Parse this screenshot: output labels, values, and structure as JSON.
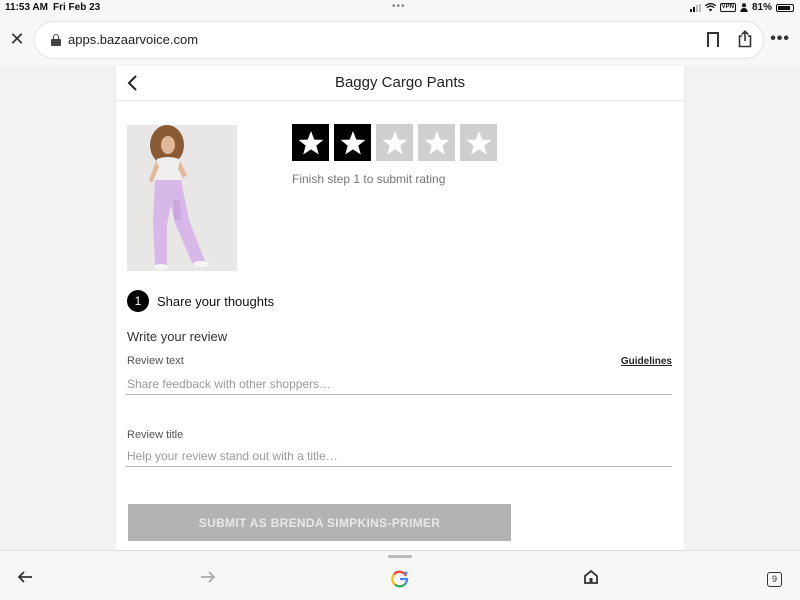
{
  "status_bar": {
    "time": "11:53 AM",
    "date": "Fri Feb 23",
    "battery": "81%",
    "vpn": "VPN",
    "icons": [
      "signal-icon",
      "wifi-icon",
      "vpn-icon",
      "person-icon",
      "battery-icon"
    ]
  },
  "browser": {
    "url": "apps.bazaarvoice.com",
    "buttons": [
      "close-icon",
      "lock-icon",
      "bookmark-icon",
      "share-icon",
      "more-icon"
    ],
    "toolbar": {
      "icons": [
        "back-arrow-icon",
        "forward-arrow-icon",
        "google-lens-icon",
        "home-icon",
        "tabs-icon"
      ],
      "tab_count": "9"
    }
  },
  "page": {
    "title": "Baggy Cargo Pants",
    "rating": {
      "value": 2,
      "max": 5,
      "hint": "Finish step 1 to submit rating"
    },
    "step": {
      "number": "1",
      "label": "Share your thoughts"
    },
    "write_review": {
      "heading": "Write your review",
      "review_text_label": "Review text",
      "guidelines": "Guidelines",
      "review_text_placeholder": "Share feedback with other shoppers…",
      "review_title_label": "Review title",
      "review_title_placeholder": "Help your review stand out with a title…"
    },
    "submit_label": "SUBMIT AS BRENDA SIMPKINS-PRIMER",
    "colors": {
      "star_active": "#000000",
      "star_inactive": "#cfcfcf",
      "submit_disabled": "#b3b3b3",
      "pants": "#d8b8e8"
    }
  }
}
